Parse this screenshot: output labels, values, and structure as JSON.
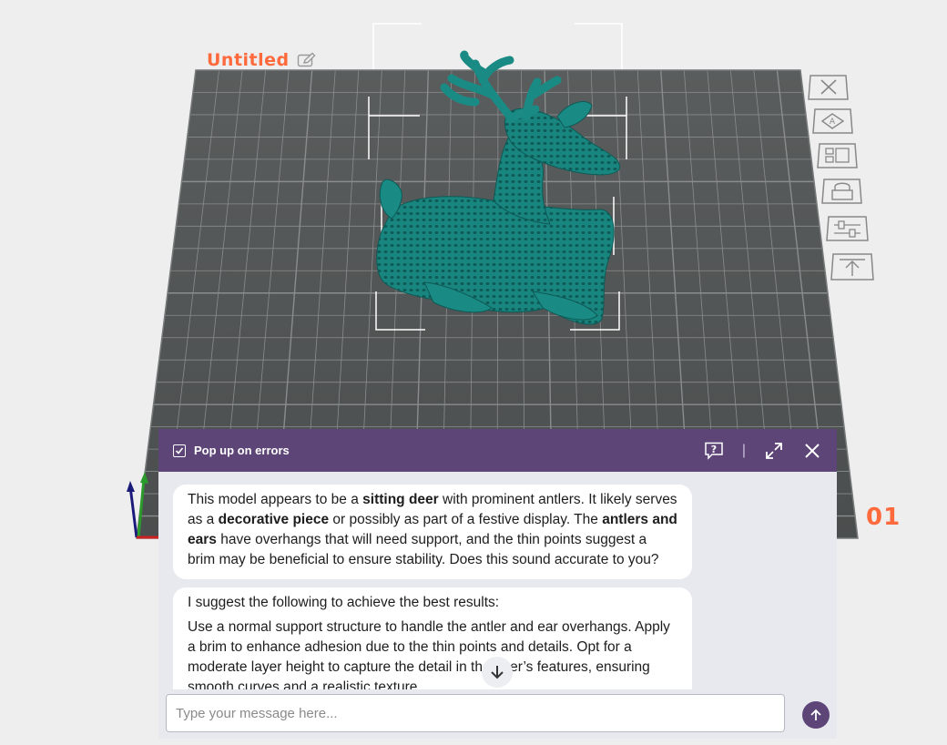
{
  "project": {
    "title": "Untitled"
  },
  "plate": {
    "number": "01"
  },
  "toolbar": {
    "items": [
      {
        "name": "delete-icon"
      },
      {
        "name": "auto-orient-icon"
      },
      {
        "name": "arrange-icon"
      },
      {
        "name": "lock-icon"
      },
      {
        "name": "plate-settings-icon"
      },
      {
        "name": "move-to-top-icon"
      }
    ]
  },
  "chat": {
    "header": {
      "checkbox_label": "Pop up on errors",
      "checkbox_checked": true
    },
    "messages": [
      {
        "parts": [
          {
            "t": "This model appears to be a ",
            "b": false
          },
          {
            "t": "sitting deer",
            "b": true
          },
          {
            "t": " with prominent antlers. It likely serves as a ",
            "b": false
          },
          {
            "t": "decorative piece",
            "b": true
          },
          {
            "t": " or possibly as part of a festive display. The ",
            "b": false
          },
          {
            "t": "antlers and ears",
            "b": true
          },
          {
            "t": " have overhangs that will need support, and the thin points suggest a brim may be beneficial to ensure stability. Does this sound accurate to you?",
            "b": false
          }
        ]
      },
      {
        "intro": "I suggest the following to achieve the best results:",
        "body": "Use a normal support structure to handle the antler and ear overhangs. Apply a brim to enhance adhesion due to the thin points and details. Opt for a moderate layer height to capture the detail in the deer’s features, ensuring smooth curves and a realistic texture."
      }
    ],
    "input": {
      "placeholder": "Type your message here..."
    }
  },
  "colors": {
    "accent": "#ff6a3d",
    "panel_header": "#5e4577",
    "model": "#1a8b84",
    "plate": "#555858",
    "grid": "#8a8d8d"
  }
}
